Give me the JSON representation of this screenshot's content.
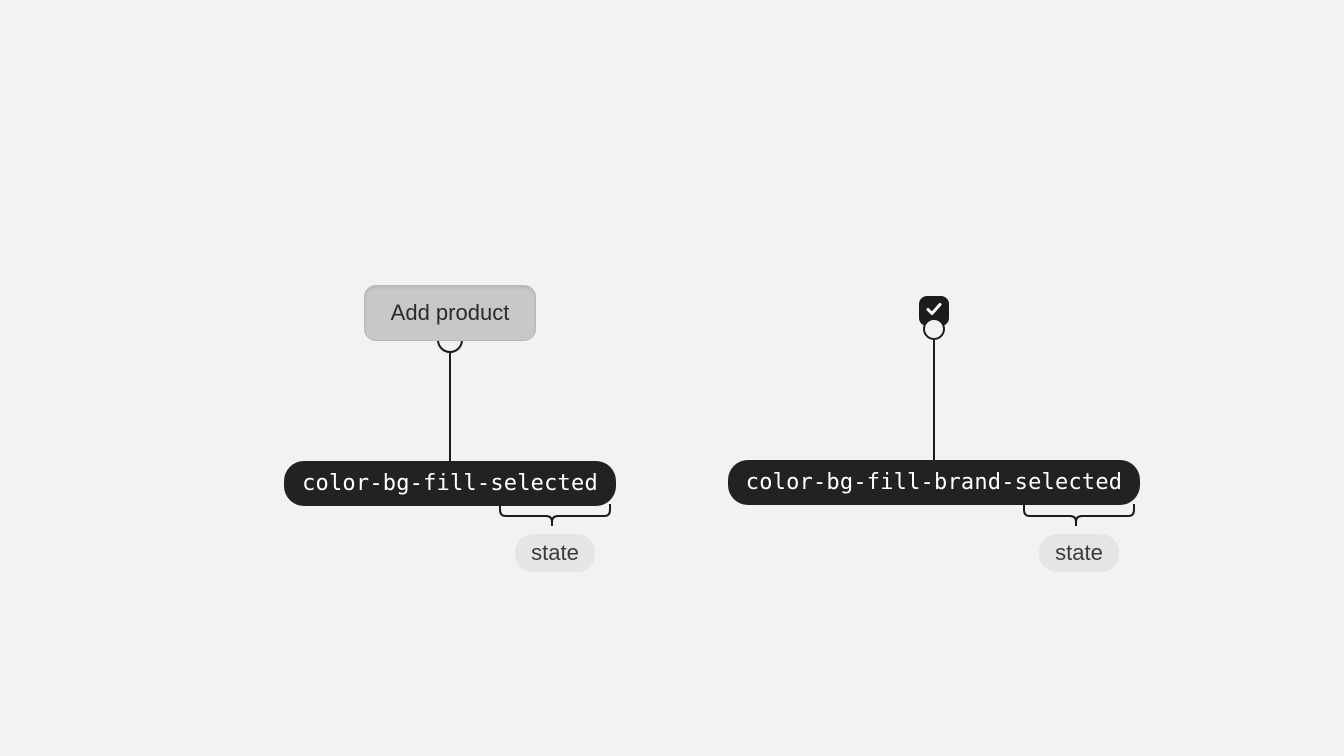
{
  "left": {
    "button_label": "Add product",
    "token": "color-bg-fill-selected",
    "state_label": "state"
  },
  "right": {
    "token": "color-bg-fill-brand-selected",
    "state_label": "state"
  },
  "colors": {
    "background": "#f2f2f2",
    "button_bg": "#c8c8c8",
    "token_bg": "#222222",
    "checkbox_bg": "#1c1c1c",
    "state_bg": "#e5e5e5"
  }
}
